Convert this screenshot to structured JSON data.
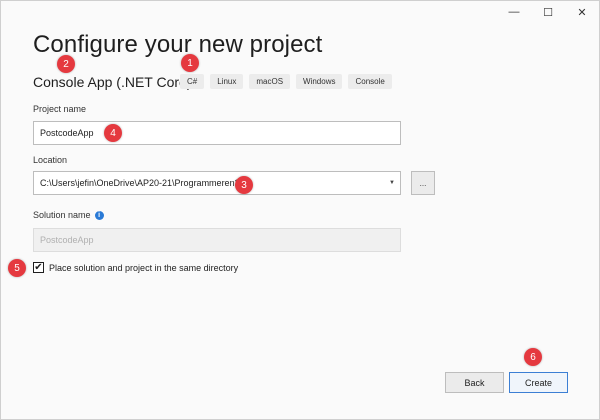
{
  "window": {
    "controls": {
      "minimize": "—",
      "maximize": "☐",
      "close": "✕"
    }
  },
  "header": {
    "title": "Configure your new project",
    "template_name": "Console App (.NET Core)",
    "tags": [
      "C#",
      "Linux",
      "macOS",
      "Windows",
      "Console"
    ]
  },
  "form": {
    "project_name_label": "Project name",
    "project_name_value": "PostcodeApp",
    "location_label": "Location",
    "location_value": "C:\\Users\\jefin\\OneDrive\\AP20-21\\Programmeren3",
    "browse_label": "...",
    "solution_name_label": "Solution name",
    "solution_name_value": "PostcodeApp",
    "same_dir_label": "Place solution and project in the same directory",
    "same_dir_checked": true
  },
  "footer": {
    "back_label": "Back",
    "create_label": "Create"
  },
  "annotations": [
    "1",
    "2",
    "3",
    "4",
    "5",
    "6"
  ],
  "colors": {
    "badge": "#e5393f",
    "accent": "#3c7fd4",
    "info": "#2a7ad6"
  }
}
